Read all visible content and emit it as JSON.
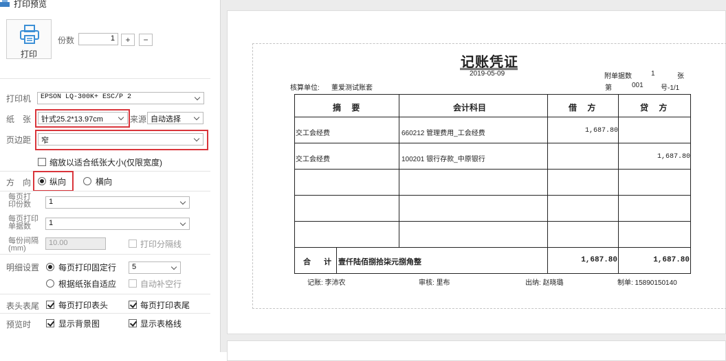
{
  "window": {
    "title": "打印预览"
  },
  "toolbar": {
    "print_label": "打印",
    "copies_label": "份数",
    "copies_value": "1",
    "plus_label": "+",
    "minus_label": "−"
  },
  "settings": {
    "printer_label": "打印机",
    "printer_value": "EPSON LQ-300K+ ESC/P 2",
    "paper_label": "纸　张",
    "paper_value": "针式25.2*13.97cm",
    "source_label": "来源",
    "source_value": "自动选择",
    "margin_label": "页边距",
    "margin_value": "窄",
    "scale_label": "缩放以适合纸张大小(仅限宽度)",
    "orientation_label": "方　向",
    "portrait_label": "纵向",
    "landscape_label": "横向",
    "copies_per_page_label_1": "每页打",
    "copies_per_page_label_2": "印份数",
    "copies_per_page_value": "1",
    "docs_per_page_label_1": "每页打印",
    "docs_per_page_label_2": "单据数",
    "docs_per_page_value": "1",
    "interval_label_1": "每份间隔",
    "interval_label_2": "(mm)",
    "interval_value": "10.00",
    "print_separator_label": "打印分隔线",
    "detail_label": "明细设置",
    "fixed_rows_label": "每页打印固定行",
    "fixed_rows_value": "5",
    "adapt_label": "根据纸张自适应",
    "autofill_label": "自动补空行",
    "header_footer_label": "表头表尾",
    "print_header_label": "每页打印表头",
    "print_footer_label": "每页打印表尾",
    "preview_label": "预览时",
    "show_bg_label": "显示背景图",
    "show_grid_label": "显示表格线"
  },
  "voucher": {
    "title": "记账凭证",
    "date": "2019-05-09",
    "attach_label": "附单据数",
    "attach_value": "1",
    "attach_unit": "张",
    "unit_label": "核算单位:",
    "unit_value": "董爱测试账套",
    "no_label": "第",
    "no_value": "001",
    "no_suffix": "号-1/1",
    "headers": [
      "摘  要",
      "会计科目",
      "借  方",
      "贷  方"
    ],
    "rows": [
      {
        "summary": "交工会经费",
        "account": "660212 管理费用_工会经费",
        "debit": "1,687.80",
        "credit": ""
      },
      {
        "summary": "交工会经费",
        "account": "100201 银行存款_中原银行",
        "debit": "",
        "credit": "1,687.80"
      }
    ],
    "total_label": "合　计",
    "total_words": "壹仟陆佰捌拾柒元捌角整",
    "total_debit": "1,687.80",
    "total_credit": "1,687.80",
    "bookkeeper": "记账: 李沛农",
    "reviewer": "审核: 里布",
    "cashier": "出纳: 赵晓璐",
    "maker": "制单: 15890150140"
  }
}
